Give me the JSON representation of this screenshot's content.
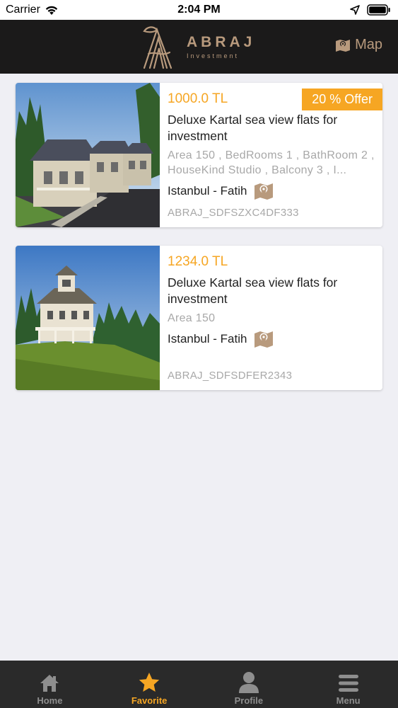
{
  "status_bar": {
    "carrier": "Carrier",
    "time": "2:04 PM"
  },
  "header": {
    "logo_title": "ABRAJ",
    "logo_subtitle": "Investment",
    "map_label": "Map"
  },
  "listings": [
    {
      "price": "1000.0 TL",
      "offer": "20 % Offer",
      "title": "Deluxe Kartal sea view flats for investment",
      "details": "Area 150 , BedRooms 1 , BathRoom 2 , HouseKind Studio , Balcony 3 , I...",
      "location": "Istanbul - Fatih",
      "code": "ABRAJ_SDFSZXC4DF333"
    },
    {
      "price": "1234.0 TL",
      "offer": "",
      "title": "Deluxe Kartal sea view flats for investment",
      "details": "Area 150",
      "location": "Istanbul - Fatih",
      "code": "ABRAJ_SDFSDFER2343"
    }
  ],
  "tabbar": {
    "tabs": [
      {
        "label": "Home",
        "icon": "home-icon",
        "active": false
      },
      {
        "label": "Favorite",
        "icon": "star-icon",
        "active": true
      },
      {
        "label": "Profile",
        "icon": "person-icon",
        "active": false
      },
      {
        "label": "Menu",
        "icon": "menu-icon",
        "active": false
      }
    ]
  },
  "colors": {
    "accent": "#f6a623",
    "header_bg": "#1b1a1a",
    "brand_gold": "#b89a7d",
    "tabbar_bg": "#2a2a2a"
  }
}
